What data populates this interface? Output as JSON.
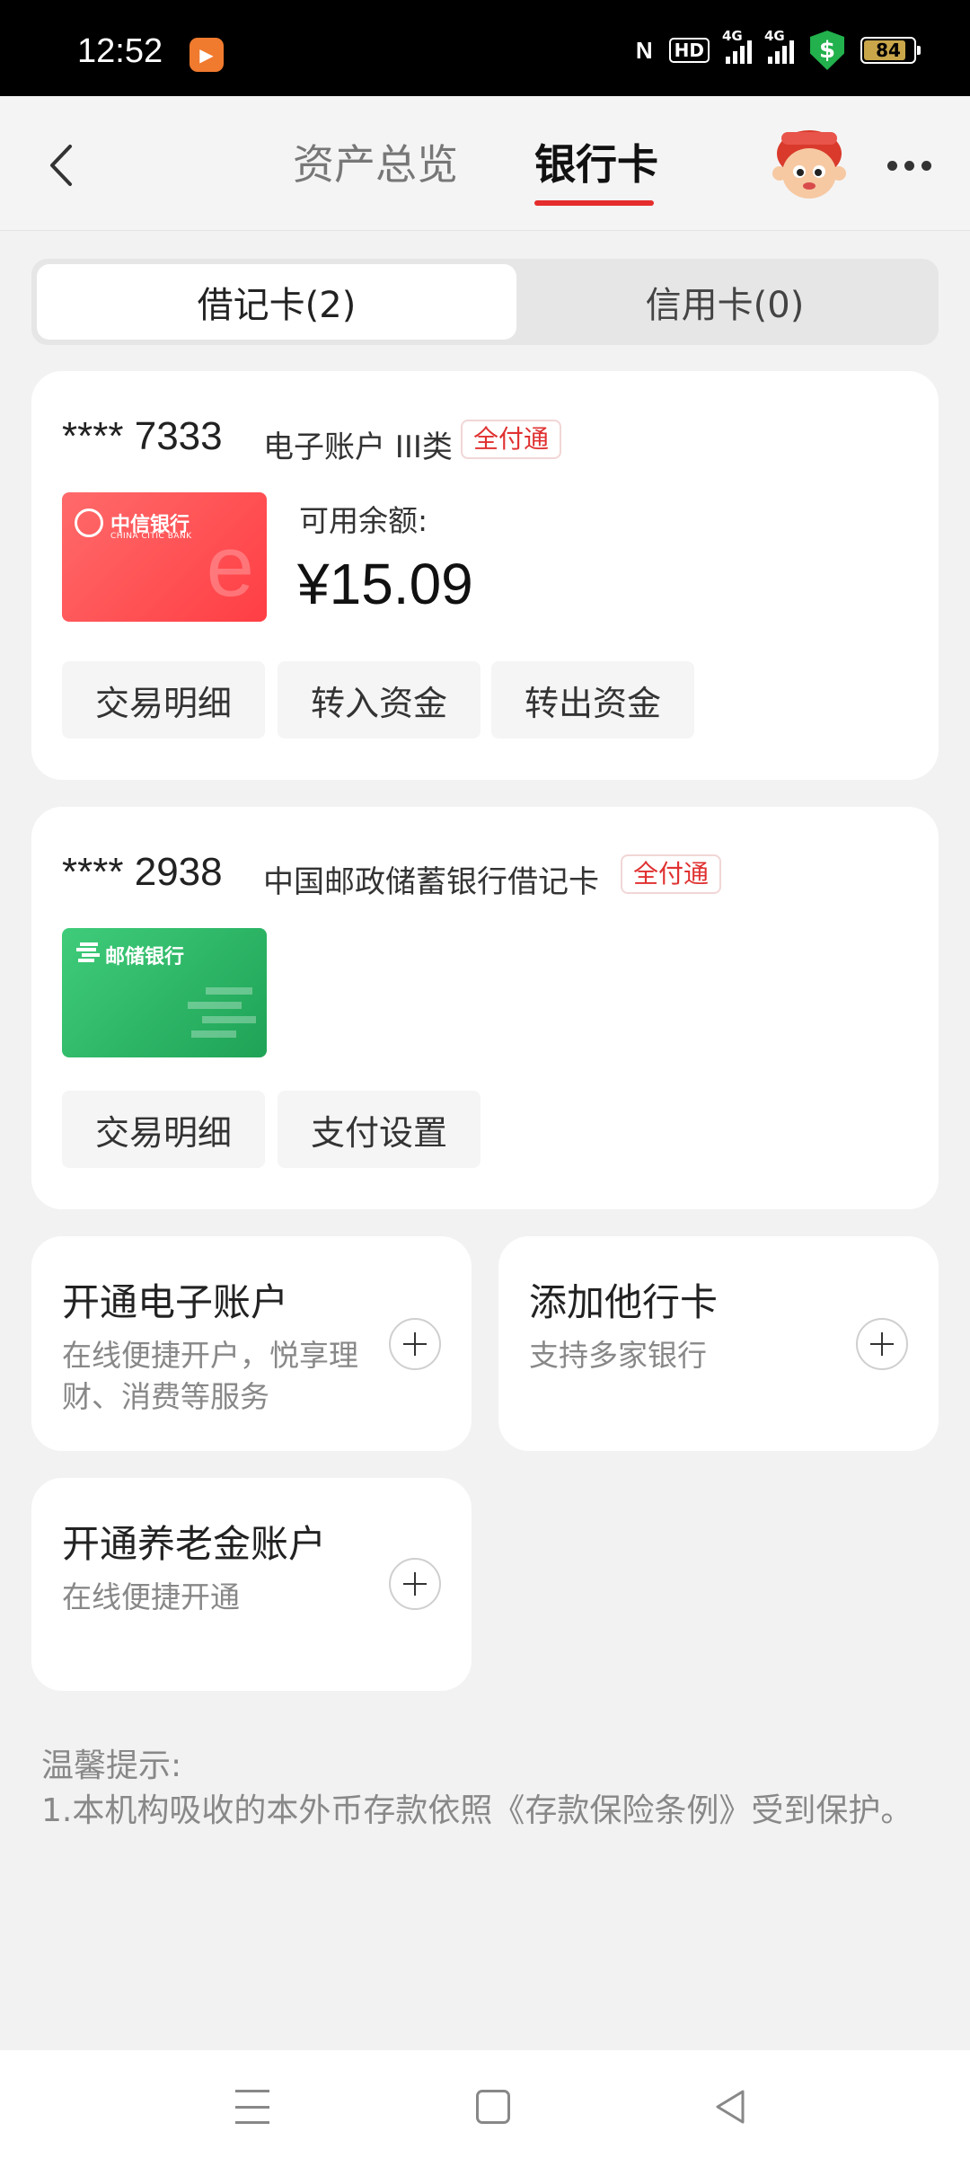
{
  "status_bar": {
    "time": "12:52",
    "app_icon": "video-app-icon",
    "nfc": "N",
    "hd": "HD",
    "signal1_label": "4G",
    "signal2_label": "4G",
    "shield_symbol": "$",
    "battery": "84"
  },
  "header": {
    "tabs": [
      {
        "label": "资产总览",
        "active": false
      },
      {
        "label": "银行卡",
        "active": true
      }
    ],
    "accent_color": "#e52d2d"
  },
  "segment": {
    "debit": "借记卡(2)",
    "credit": "信用卡(0)",
    "selected": "debit"
  },
  "cards": [
    {
      "number": "**** 7333",
      "type": "电子账户 III类",
      "badge": "全付通",
      "bank_name": "中信银行",
      "bank_sub": "CHINA CITIC BANK",
      "balance_label": "可用余额:",
      "balance": "¥15.09",
      "actions": [
        "交易明细",
        "转入资金",
        "转出资金"
      ]
    },
    {
      "number": "**** 2938",
      "type": "中国邮政储蓄银行借记卡",
      "badge": "全付通",
      "bank_name": "邮储银行",
      "actions": [
        "交易明细",
        "支付设置"
      ]
    }
  ],
  "services": [
    {
      "title": "开通电子账户",
      "desc": "在线便捷开户，悦享理财、消费等服务"
    },
    {
      "title": "添加他行卡",
      "desc": "支持多家银行"
    },
    {
      "title": "开通养老金账户",
      "desc": "在线便捷开通"
    }
  ],
  "tips": {
    "title": "温馨提示:",
    "body": "1.本机构吸收的本外币存款依照《存款保险条例》受到保护。"
  }
}
